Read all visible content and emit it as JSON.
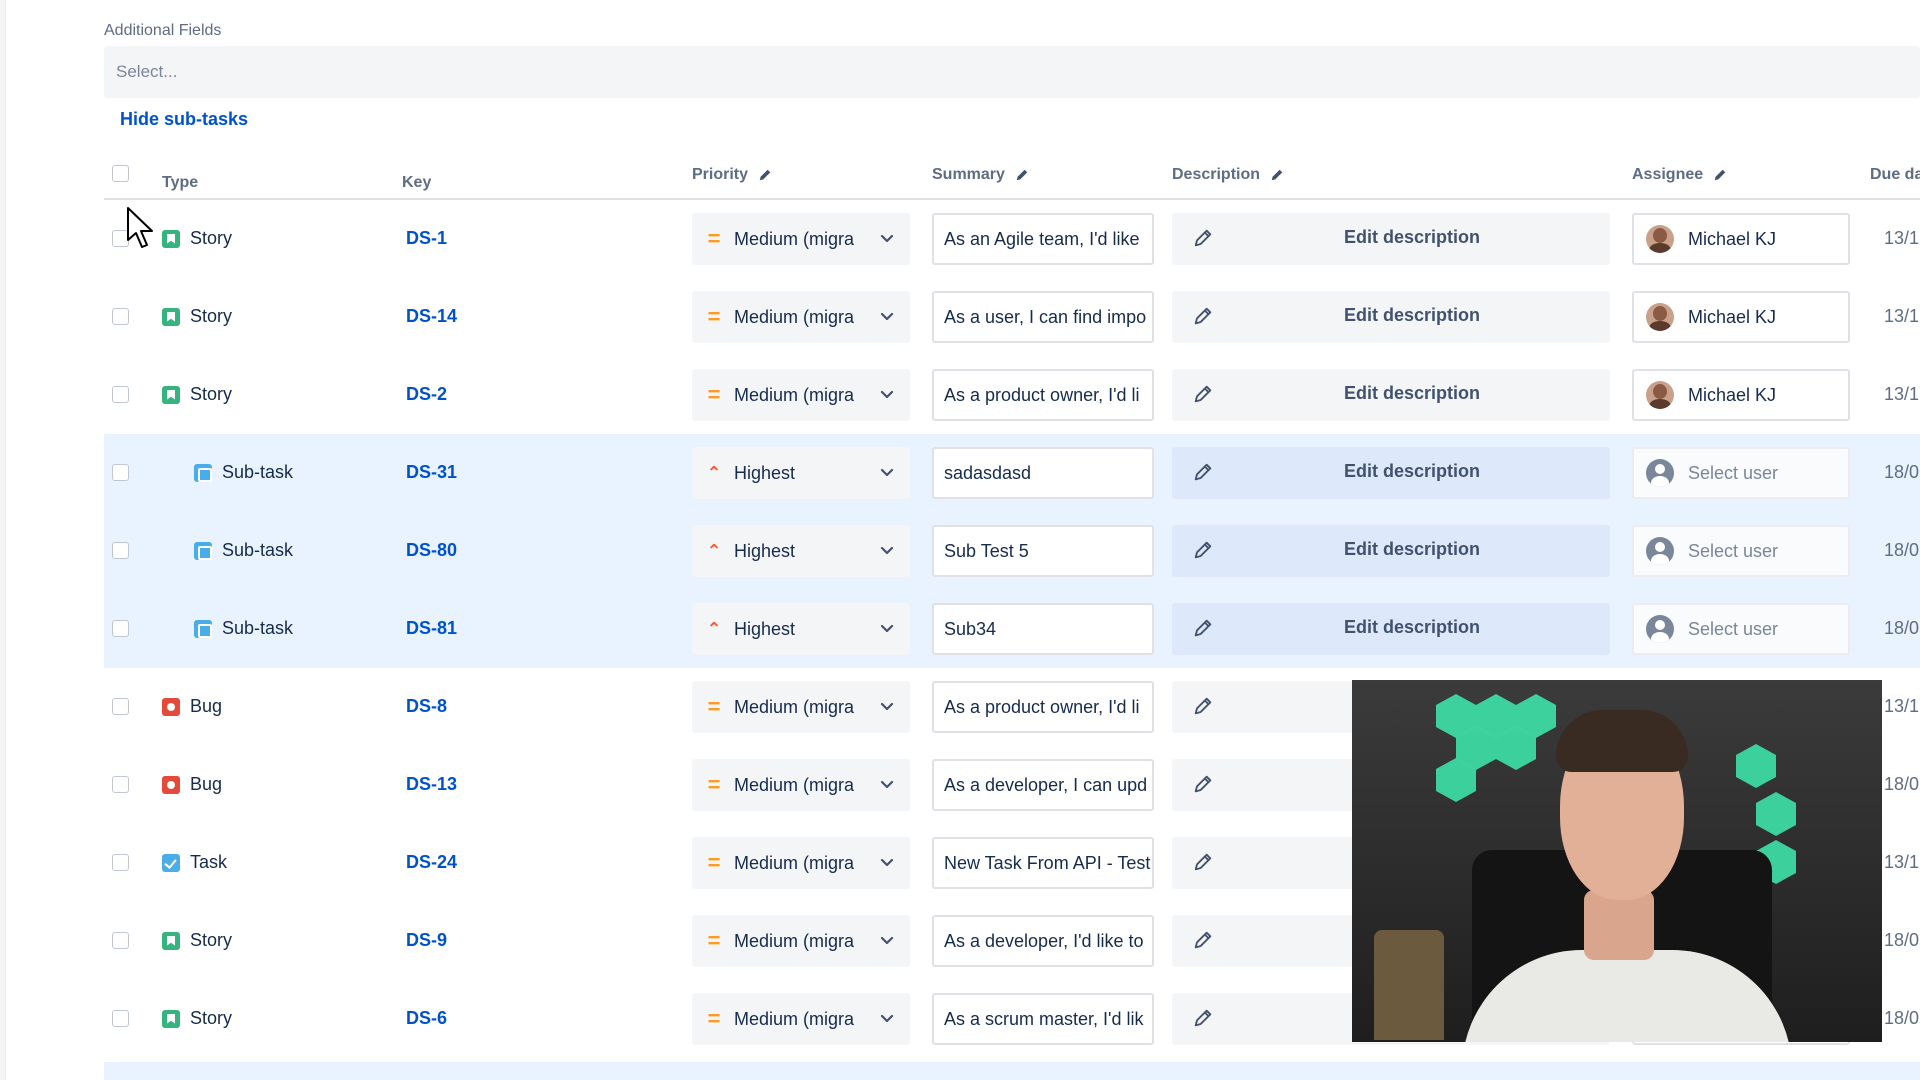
{
  "additional_fields": {
    "label": "Additional Fields",
    "placeholder": "Select..."
  },
  "hide_subtasks_label": "Hide sub-tasks",
  "columns": {
    "type": "Type",
    "key": "Key",
    "priority": "Priority",
    "summary": "Summary",
    "description": "Description",
    "assignee": "Assignee",
    "due": "Due da"
  },
  "rows": [
    {
      "type": "Story",
      "type_icon": "story-icon",
      "key": "DS-1",
      "priority": "Medium (migra",
      "priority_icon": "medium-priority-icon",
      "summary": "As an Agile team, I'd like",
      "description": "Edit description",
      "assignee": "Michael KJ",
      "due": "13/1",
      "subtask": false
    },
    {
      "type": "Story",
      "type_icon": "story-icon",
      "key": "DS-14",
      "priority": "Medium (migra",
      "priority_icon": "medium-priority-icon",
      "summary": "As a user, I can find impo",
      "description": "Edit description",
      "assignee": "Michael KJ",
      "due": "13/1",
      "subtask": false
    },
    {
      "type": "Story",
      "type_icon": "story-icon",
      "key": "DS-2",
      "priority": "Medium (migra",
      "priority_icon": "medium-priority-icon",
      "summary": "As a product owner, I'd li",
      "description": "Edit description",
      "assignee": "Michael KJ",
      "due": "13/1",
      "subtask": false
    },
    {
      "type": "Sub-task",
      "type_icon": "subtask-icon",
      "key": "DS-31",
      "priority": "Highest",
      "priority_icon": "highest-priority-icon",
      "summary": "sadasdasd",
      "description": "Edit description",
      "assignee": "Select user",
      "due": "18/0",
      "subtask": true
    },
    {
      "type": "Sub-task",
      "type_icon": "subtask-icon",
      "key": "DS-80",
      "priority": "Highest",
      "priority_icon": "highest-priority-icon",
      "summary": "Sub Test 5",
      "description": "Edit description",
      "assignee": "Select user",
      "due": "18/0",
      "subtask": true
    },
    {
      "type": "Sub-task",
      "type_icon": "subtask-icon",
      "key": "DS-81",
      "priority": "Highest",
      "priority_icon": "highest-priority-icon",
      "summary": "Sub34",
      "description": "Edit description",
      "assignee": "Select user",
      "due": "18/0",
      "subtask": true
    },
    {
      "type": "Bug",
      "type_icon": "bug-icon",
      "key": "DS-8",
      "priority": "Medium (migra",
      "priority_icon": "medium-priority-icon",
      "summary": "As a product owner, I'd li",
      "description": "",
      "assignee": "",
      "due": "13/1",
      "subtask": false
    },
    {
      "type": "Bug",
      "type_icon": "bug-icon",
      "key": "DS-13",
      "priority": "Medium (migra",
      "priority_icon": "medium-priority-icon",
      "summary": "As a developer, I can upd",
      "description": "",
      "assignee": "",
      "due": "18/0",
      "subtask": false
    },
    {
      "type": "Task",
      "type_icon": "task-icon",
      "key": "DS-24",
      "priority": "Medium (migra",
      "priority_icon": "medium-priority-icon",
      "summary": "New Task From API - Test",
      "description": "",
      "assignee": "",
      "due": "13/1",
      "subtask": false
    },
    {
      "type": "Story",
      "type_icon": "story-icon",
      "key": "DS-9",
      "priority": "Medium (migra",
      "priority_icon": "medium-priority-icon",
      "summary": "As a developer, I'd like to",
      "description": "",
      "assignee": "",
      "due": "18/0",
      "subtask": false
    },
    {
      "type": "Story",
      "type_icon": "story-icon",
      "key": "DS-6",
      "priority": "Medium (migra",
      "priority_icon": "medium-priority-icon",
      "summary": "As a scrum master, I'd lik",
      "description": "",
      "assignee": "",
      "due": "18/0",
      "subtask": false
    }
  ],
  "colors": {
    "link": "#0052cc",
    "subtask_row_bg": "#e9f2ff",
    "story": "#36b37e",
    "bug": "#e5493a",
    "task": "#4bade8",
    "priority_medium": "#ff991f",
    "priority_highest": "#ff5630"
  }
}
